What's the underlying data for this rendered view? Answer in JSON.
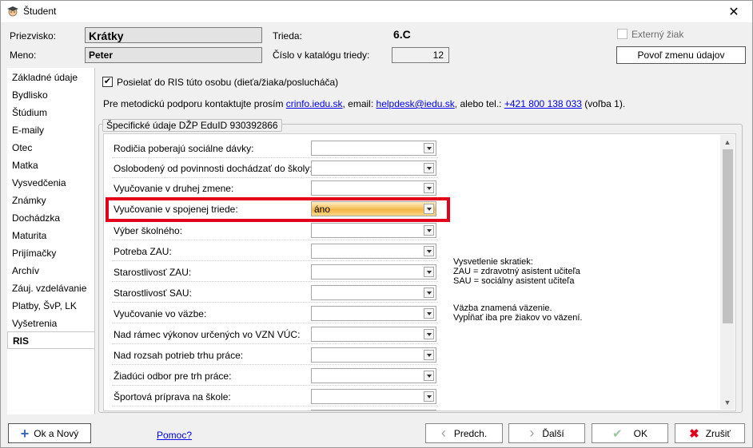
{
  "window": {
    "title": "Študent",
    "close": "✕"
  },
  "header": {
    "surname_label": "Priezvisko:",
    "surname_value": "Krátky",
    "name_label": "Meno:",
    "name_value": "Peter",
    "class_label": "Trieda:",
    "class_value": "6.C",
    "catalog_label": "Číslo v katalógu triedy:",
    "catalog_value": "12",
    "external_label": "Externý žiak",
    "allow_change_label": "Povoľ zmenu údajov"
  },
  "sidebar": {
    "items": [
      {
        "label": "Základné údaje"
      },
      {
        "label": "Bydlisko"
      },
      {
        "label": "Štúdium"
      },
      {
        "label": "E-maily"
      },
      {
        "label": "Otec"
      },
      {
        "label": "Matka"
      },
      {
        "label": "Vysvedčenia"
      },
      {
        "label": "Známky"
      },
      {
        "label": "Dochádzka"
      },
      {
        "label": "Maturita"
      },
      {
        "label": "Prijímačky"
      },
      {
        "label": "Archív"
      },
      {
        "label": "Záuj. vzdelávanie"
      },
      {
        "label": "Platby, ŠvP, LK"
      },
      {
        "label": "Vyšetrenia"
      },
      {
        "label": "RIS"
      }
    ]
  },
  "ris": {
    "send_checkbox_label": "Posielať do RIS túto osobu (dieťa/žiaka/poslucháča)",
    "support_prefix": "Pre metodickú podporu kontaktujte prosím",
    "support_link1": "crinfo.iedu.sk",
    "support_mid": ", email:",
    "support_link2": "helpdesk@iedu.sk",
    "support_mid2": ", alebo tel.:",
    "support_link3": "+421 800 138 033",
    "support_suffix": "(voľba 1).",
    "group_title": "Špecifické údaje DŽP EduID 930392866",
    "rows": [
      {
        "label": "Rodičia poberajú sociálne dávky:",
        "value": ""
      },
      {
        "label": "Oslobodený od povinnosti dochádzať do školy:",
        "value": ""
      },
      {
        "label": "Vyučovanie v druhej zmene:",
        "value": ""
      },
      {
        "label": "Vyučovanie v spojenej triede:",
        "value": "áno"
      },
      {
        "label": "Výber školného:",
        "value": ""
      },
      {
        "label": "Potreba ZAU:",
        "value": ""
      },
      {
        "label": "Starostlivosť ZAU:",
        "value": ""
      },
      {
        "label": "Starostlivosť SAU:",
        "value": ""
      },
      {
        "label": "Vyučovanie vo väzbe:",
        "value": ""
      },
      {
        "label": "Nad rámec výkonov určených vo VZN VÚC:",
        "value": ""
      },
      {
        "label": "Nad rozsah potrieb trhu práce:",
        "value": ""
      },
      {
        "label": "Žiadúci odbor pre trh práce:",
        "value": ""
      },
      {
        "label": "Športová príprava na škole:",
        "value": ""
      }
    ],
    "note1_line1": "Vysvetlenie skratiek:",
    "note1_line2": "ZAU = zdravotný asistent učiteľa",
    "note1_line3": "SAU = sociálny asistent učiteľa",
    "note2_line1": "Väzba znamená väzenie.",
    "note2_line2": "Vypĺňať iba pre žiakov vo väzení."
  },
  "footer": {
    "ok_new": "Ok a Nový",
    "help": "Pomoc?",
    "prev": "Predch.",
    "next": "Ďalší",
    "ok": "OK",
    "cancel": "Zrušiť"
  },
  "colors": {
    "accent_highlight": "#e2001a",
    "link": "#0000ee",
    "selected_combo": "#f5c05a"
  }
}
